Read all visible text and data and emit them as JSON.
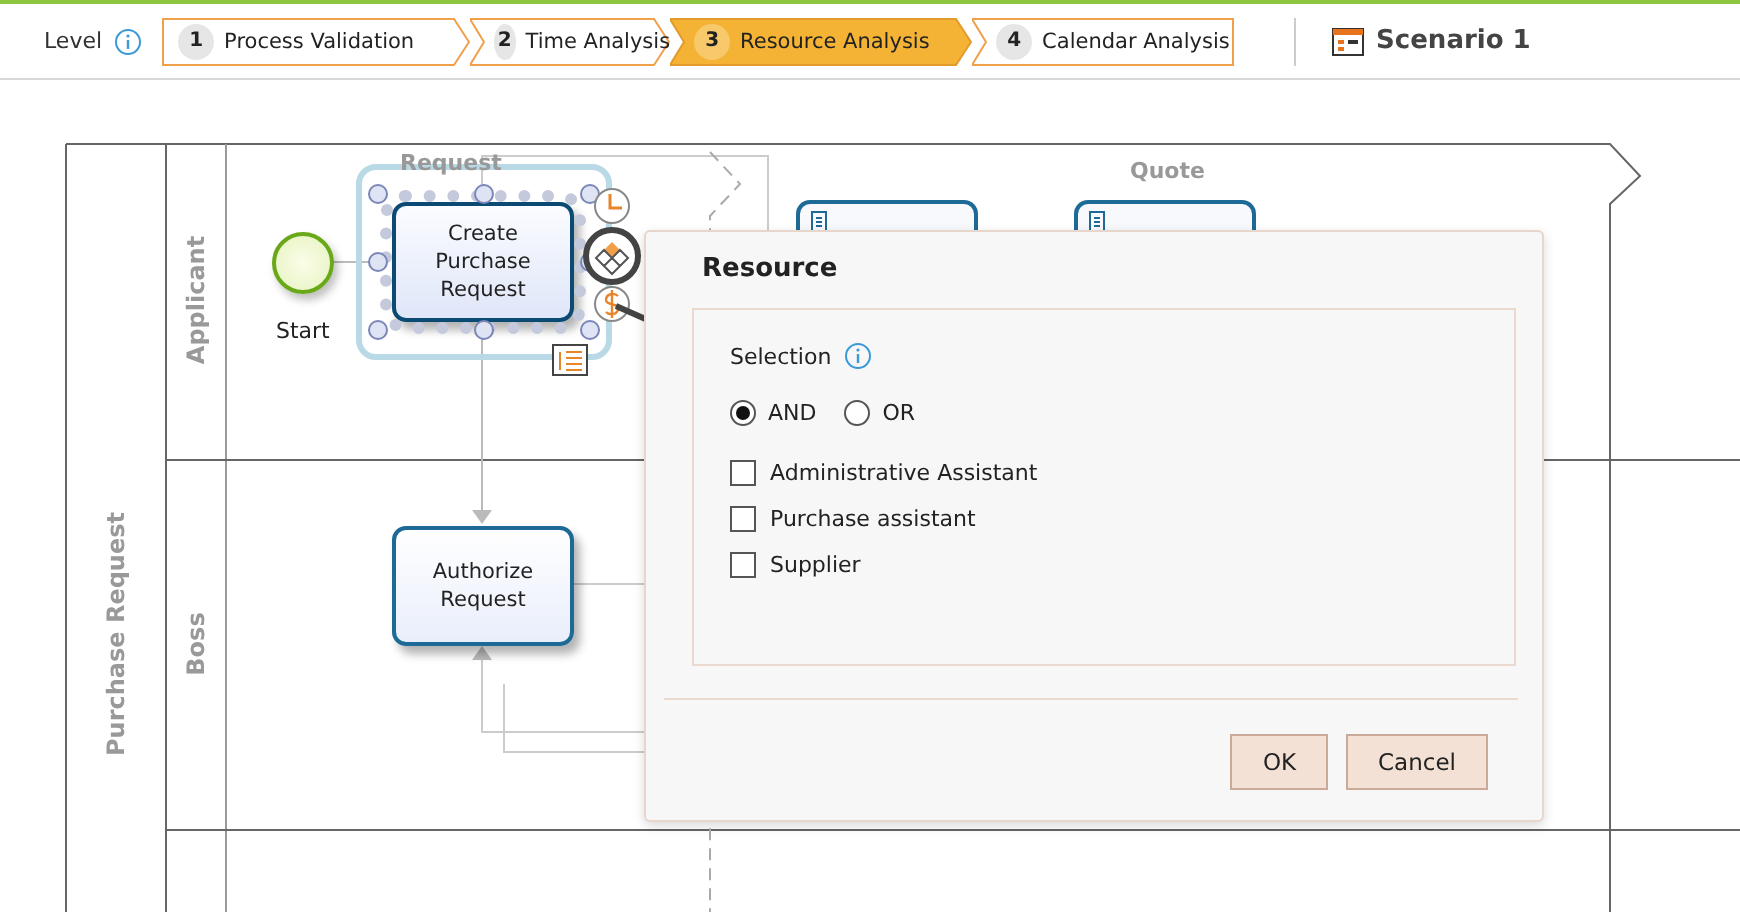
{
  "level": {
    "label": "Level"
  },
  "steps": [
    {
      "number": "1",
      "label": "Process Validation",
      "selected": false
    },
    {
      "number": "2",
      "label": "Time Analysis",
      "selected": false
    },
    {
      "number": "3",
      "label": "Resource Analysis",
      "selected": true
    },
    {
      "number": "4",
      "label": "Calendar Analysis",
      "selected": false
    }
  ],
  "scenario": {
    "title": "Scenario 1"
  },
  "pool": {
    "label": "Purchase Request",
    "lanes": [
      {
        "label": "Applicant"
      },
      {
        "label": "Boss"
      }
    ]
  },
  "groups": [
    {
      "label": "Request"
    },
    {
      "label": "Quote"
    }
  ],
  "start_event": {
    "label": "Start"
  },
  "tasks": [
    {
      "label": "Create Purchase Request",
      "selected": true
    },
    {
      "label": "Authorize Request",
      "selected": false
    }
  ],
  "dialog": {
    "title": "Resource",
    "section_label": "Selection",
    "operators": [
      {
        "label": "AND",
        "selected": true
      },
      {
        "label": "OR",
        "selected": false
      }
    ],
    "resources": [
      {
        "label": "Administrative Assistant",
        "checked": false
      },
      {
        "label": "Purchase assistant",
        "checked": false
      },
      {
        "label": "Supplier",
        "checked": false
      }
    ],
    "buttons": [
      "OK",
      "Cancel"
    ]
  }
}
